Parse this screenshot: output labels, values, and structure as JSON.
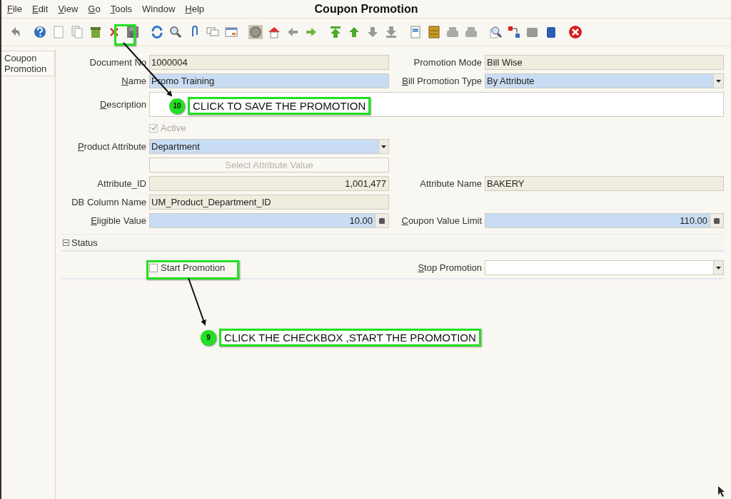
{
  "menu": [
    {
      "label": "File",
      "mnemonic": true
    },
    {
      "label": "Edit",
      "mnemonic": true
    },
    {
      "label": "View",
      "mnemonic": true
    },
    {
      "label": "Go",
      "mnemonic": true
    },
    {
      "label": "Tools",
      "mnemonic": true
    },
    {
      "label": "Window",
      "mnemonic": false
    },
    {
      "label": "Help",
      "mnemonic": true
    }
  ],
  "window": {
    "title": "Coupon Promotion"
  },
  "tabs": [
    {
      "label": "Coupon Promotion",
      "selected": true
    }
  ],
  "form": {
    "rows": [
      [
        {
          "kind": "text",
          "label": "Document No",
          "mnemonic": false,
          "value": "1000004",
          "readonly": true
        },
        {
          "kind": "text",
          "label": "Promotion Mode",
          "mnemonic": false,
          "value": "Bill Wise",
          "readonly": true
        }
      ],
      [
        {
          "kind": "text",
          "label": "Name",
          "mnemonic": true,
          "value": "Promo Training",
          "readonly": false,
          "mandatory": true
        },
        {
          "kind": "combo",
          "label": "Bill Promotion Type",
          "mnemonic": true,
          "value": "By Attribute",
          "readonly": false,
          "mandatory": true
        }
      ],
      [
        {
          "kind": "memo",
          "label": "Description",
          "mnemonic": true,
          "readonly": false,
          "mandatory": false
        }
      ],
      [
        {
          "kind": "checkbox",
          "label": "Active",
          "checked": true,
          "disabled": true
        }
      ],
      [
        {
          "kind": "combo",
          "label": "Product Attribute",
          "mnemonic": true,
          "value": "Department",
          "readonly": false,
          "mandatory": true
        }
      ],
      [
        {
          "kind": "button",
          "label": "Select Attribute Value",
          "disabled": true
        }
      ],
      [
        {
          "kind": "number",
          "label": "Attribute_ID",
          "mnemonic": false,
          "value": "1,001,477",
          "readonly": true
        },
        {
          "kind": "text",
          "label": "Attribute Name",
          "mnemonic": false,
          "value": "BAKERY",
          "readonly": true
        }
      ],
      [
        {
          "kind": "text",
          "label": "DB Column Name",
          "mnemonic": false,
          "value": "UM_Product_Department_ID",
          "readonly": true
        }
      ],
      [
        {
          "kind": "number",
          "label": "Eligible Value",
          "mnemonic": true,
          "value": "10.00",
          "readonly": false,
          "mandatory": true
        },
        {
          "kind": "number",
          "label": "Coupon Value Limit",
          "mnemonic": true,
          "value": "110.00",
          "readonly": false,
          "mandatory": true
        }
      ]
    ]
  },
  "status_section": {
    "title": "Status",
    "expanded": true,
    "rows": [
      [
        {
          "kind": "checkbox",
          "label": "Start Promotion",
          "checked": false,
          "disabled": false
        },
        {
          "kind": "combo",
          "label": "Stop Promotion",
          "mnemonic": true,
          "readonly": false,
          "mandatory": false
        }
      ]
    ]
  },
  "annotations": [
    {
      "number": "10",
      "text": "CLICK TO SAVE THE PROMOTION"
    },
    {
      "number": "9",
      "text": "CLICK THE CHECKBOX ,START THE PROMOTION"
    }
  ]
}
